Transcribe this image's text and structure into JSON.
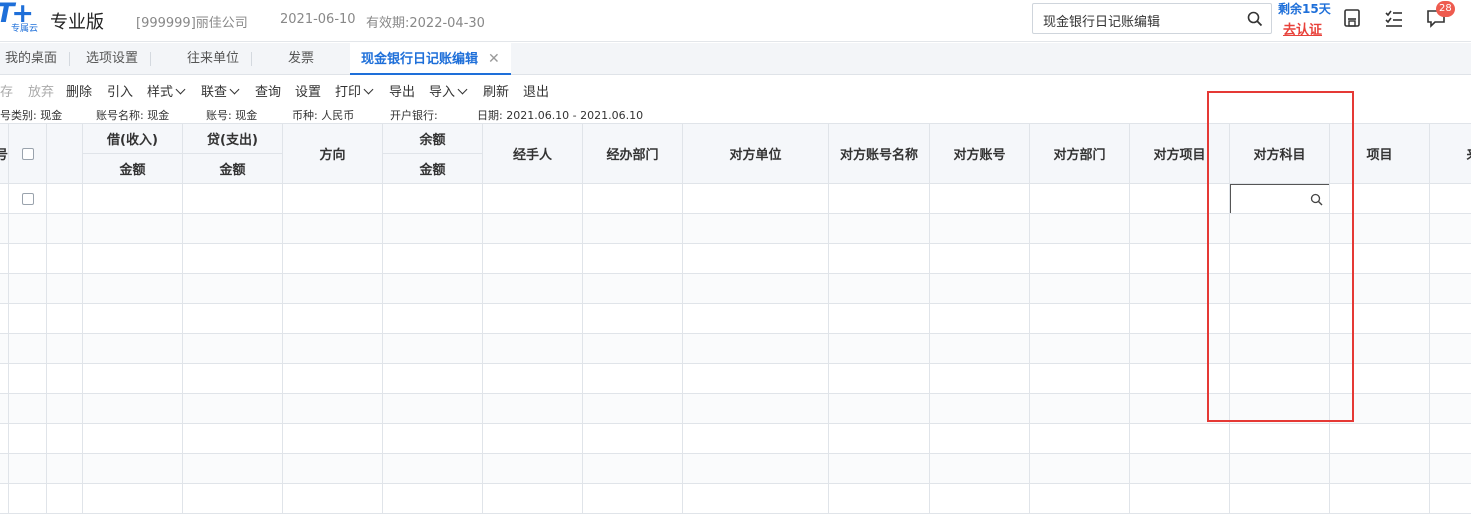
{
  "header": {
    "logo_text": "T+",
    "logo_sub": "专属云",
    "edition": "专业版",
    "company": "[999999]丽佳公司",
    "date": "2021-06-10",
    "validity": "有效期:2022-04-30",
    "search_value": "现金银行日记账编辑",
    "trial_days": "剩余15天",
    "certify_link": "去认证",
    "notification_count": "28",
    "icons": [
      "save-icon",
      "checklist-icon",
      "message-icon"
    ]
  },
  "tabs": [
    {
      "label": "我的桌面",
      "active": false
    },
    {
      "label": "选项设置",
      "active": false
    },
    {
      "label": "往来单位",
      "active": false
    },
    {
      "label": "发票",
      "active": false
    },
    {
      "label": "现金银行日记账编辑",
      "active": true,
      "close": "✕"
    }
  ],
  "toolbar": {
    "save": "存",
    "discard": "放弃",
    "delete": "删除",
    "import_ref": "引入",
    "style": "样式",
    "link_query": "联查",
    "query": "查询",
    "settings": "设置",
    "print": "打印",
    "export": "导出",
    "import": "导入",
    "refresh": "刷新",
    "exit": "退出"
  },
  "info": {
    "account_type": "号类别: 现金",
    "account_name": "账号名称: 现金",
    "account_no": "账号: 现金",
    "currency": "币种: 人民币",
    "bank": "开户银行:",
    "date_range": "日期: 2021.06.10 - 2021.06.10"
  },
  "grid": {
    "columns": {
      "seq": "号",
      "debit": "借(收入)",
      "credit": "贷(支出)",
      "direction": "方向",
      "balance": "余额",
      "amount": "金额",
      "handler": "经手人",
      "department": "经办部门",
      "counter_unit": "对方单位",
      "counter_account_name": "对方账号名称",
      "counter_account": "对方账号",
      "counter_department": "对方部门",
      "counter_project": "对方项目",
      "counter_subject": "对方科目",
      "project": "项目",
      "source": "来源"
    },
    "row_count": 11
  },
  "colors": {
    "accent": "#1e6fd9",
    "alert": "#e8413a",
    "annotation": "#e53935"
  }
}
